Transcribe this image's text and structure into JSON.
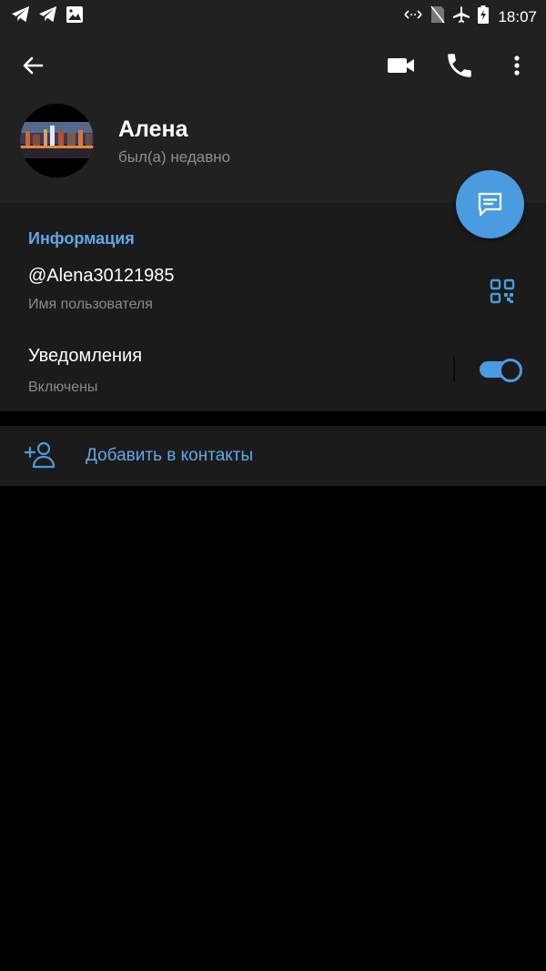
{
  "status_bar": {
    "time": "18:07",
    "left_icons": [
      "telegram-icon",
      "telegram-icon",
      "image-icon"
    ],
    "right_icons": [
      "data-saver-icon",
      "no-sim-icon",
      "airplane-icon",
      "battery-charging-icon"
    ]
  },
  "header": {
    "name": "Алена",
    "status": "был(а) недавно",
    "actions": [
      "back-arrow-icon",
      "video-call-icon",
      "phone-icon",
      "more-vert-icon"
    ]
  },
  "info": {
    "title": "Информация",
    "username": "@Alena30121985",
    "username_label": "Имя пользователя",
    "notifications_label": "Уведомления",
    "notifications_value": "Включены",
    "notifications_enabled": true
  },
  "add_contact": {
    "label": "Добавить в контакты"
  },
  "colors": {
    "accent": "#4a9be0",
    "accent_text": "#62a8e8",
    "header_bg": "#212121",
    "section_bg": "#1b1b1b",
    "page_bg": "#000000"
  }
}
